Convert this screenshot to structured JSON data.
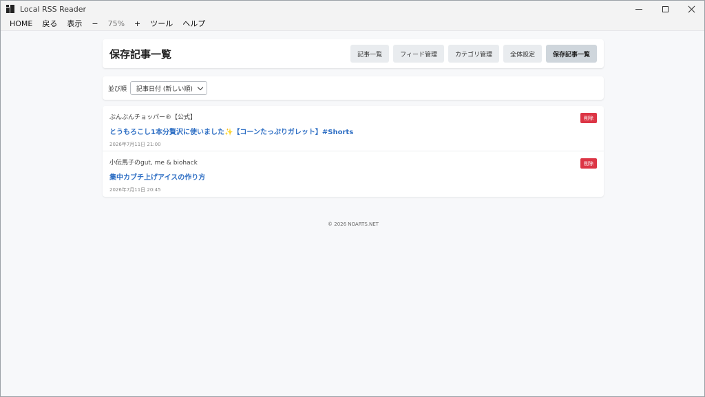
{
  "window": {
    "title": "Local RSS Reader"
  },
  "menu": {
    "items": [
      "HOME",
      "戻る",
      "表示",
      "−",
      "75%",
      "+",
      "ツール",
      "ヘルプ"
    ]
  },
  "header": {
    "title": "保存記事一覧",
    "nav": [
      {
        "label": "記事一覧",
        "active": false
      },
      {
        "label": "フィード管理",
        "active": false
      },
      {
        "label": "カテゴリ管理",
        "active": false
      },
      {
        "label": "全体設定",
        "active": false
      },
      {
        "label": "保存記事一覧",
        "active": true
      }
    ]
  },
  "sort": {
    "label": "並び順",
    "selected": "記事日付 (新しい順)"
  },
  "articles": [
    {
      "feed": "ぶんぶんチョッパー®【公式】",
      "title": "とうもろこし1本分贅沢に使いました✨【コーンたっぷりガレット】#Shorts",
      "date": "2026年7月11日 21:00",
      "delete_label": "削除"
    },
    {
      "feed": "小伝馬子のgut, me & biohack",
      "title": "集中カブチ上げアイスの作り方",
      "date": "2026年7月11日 20:45",
      "delete_label": "削除"
    }
  ],
  "footer": {
    "text": "© 2026 NOARTS.NET"
  },
  "colors": {
    "accent_link": "#2f6fc4",
    "danger": "#dc3545",
    "active_nav": "#cfd6dc",
    "nav_bg": "#e9ecef",
    "page_bg": "#f7f8fa"
  }
}
